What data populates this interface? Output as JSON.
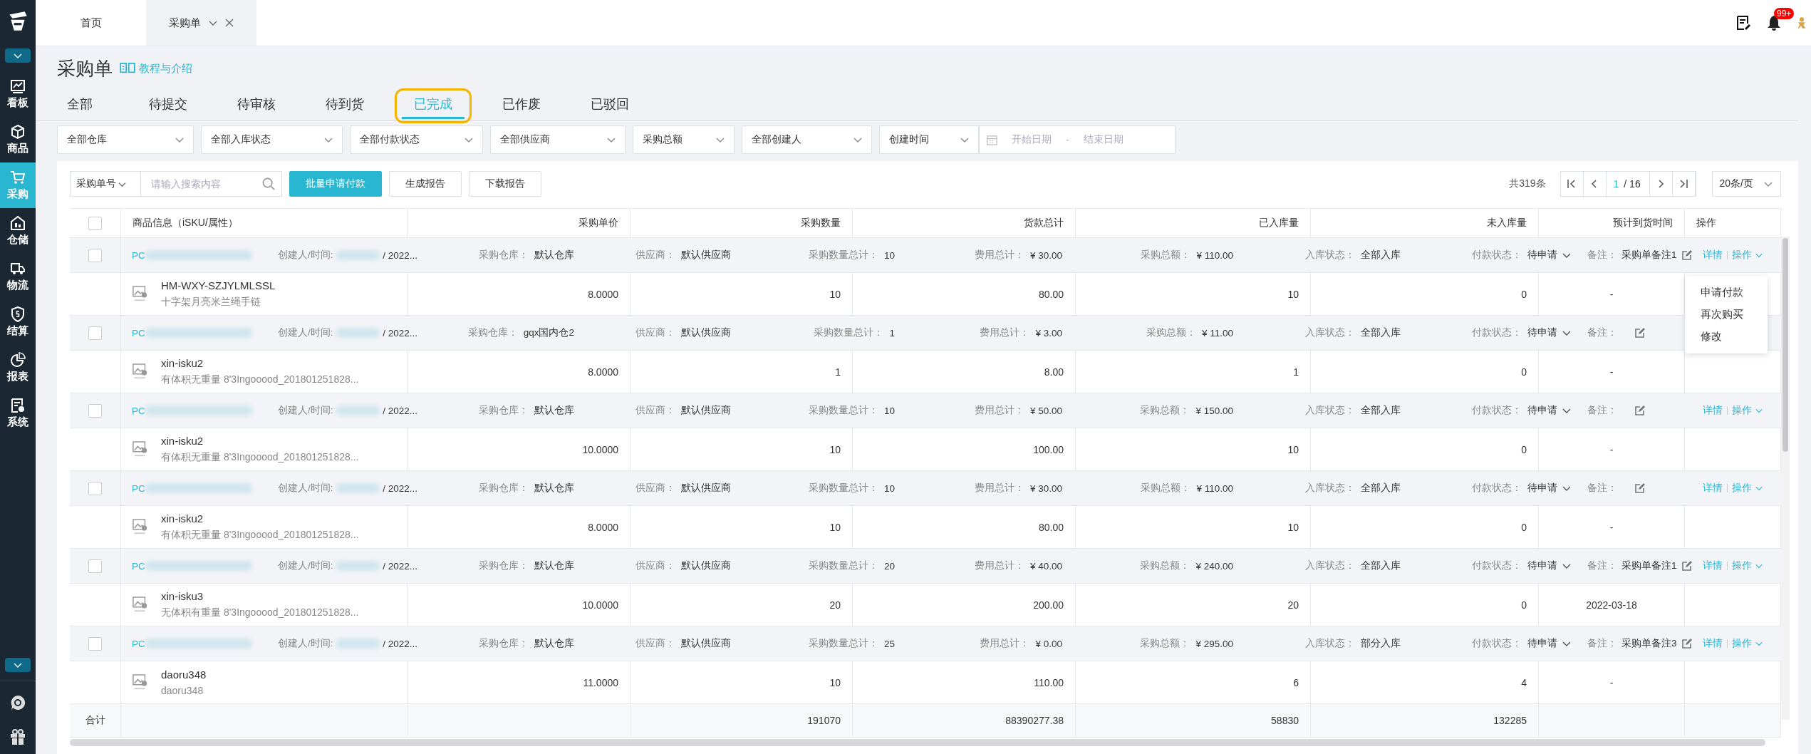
{
  "sidebar": {
    "items": [
      {
        "label": "看板",
        "kind": "chart",
        "selected": false
      },
      {
        "label": "商品",
        "kind": "cube",
        "selected": false
      },
      {
        "label": "采购",
        "kind": "cart",
        "selected": true
      },
      {
        "label": "仓储",
        "kind": "warehouse",
        "selected": false
      },
      {
        "label": "物流",
        "kind": "truck",
        "selected": false
      },
      {
        "label": "结算",
        "kind": "shield",
        "selected": false
      },
      {
        "label": "报表",
        "kind": "pie",
        "selected": false
      },
      {
        "label": "系统",
        "kind": "doc",
        "selected": false
      }
    ]
  },
  "top_tabs": [
    {
      "label": "首页",
      "selected": false,
      "closable": false
    },
    {
      "label": "采购单",
      "selected": true,
      "closable": true
    }
  ],
  "notifications": {
    "badge": "99+"
  },
  "page": {
    "title": "采购单",
    "help_link": "教程与介绍"
  },
  "status_tabs": [
    {
      "label": "全部",
      "selected": false,
      "highlighted": false
    },
    {
      "label": "待提交",
      "selected": false,
      "highlighted": false
    },
    {
      "label": "待审核",
      "selected": false,
      "highlighted": false
    },
    {
      "label": "待到货",
      "selected": false,
      "highlighted": false
    },
    {
      "label": "已完成",
      "selected": true,
      "highlighted": true
    },
    {
      "label": "已作废",
      "selected": false,
      "highlighted": false
    },
    {
      "label": "已驳回",
      "selected": false,
      "highlighted": false
    }
  ],
  "filters": [
    {
      "label": "全部仓库"
    },
    {
      "label": "全部入库状态"
    },
    {
      "label": "全部付款状态"
    },
    {
      "label": "全部供应商"
    },
    {
      "label": "采购总额"
    },
    {
      "label": "全部创建人"
    },
    {
      "label": "创建时间"
    }
  ],
  "date_range": {
    "start_placeholder": "开始日期",
    "separator": "-",
    "end_placeholder": "结束日期"
  },
  "toolbar": {
    "search_type": "采购单号",
    "search_placeholder": "请输入搜索内容",
    "buttons": [
      {
        "label": "批量申请付款",
        "primary": true
      },
      {
        "label": "生成报告",
        "primary": false
      },
      {
        "label": "下载报告",
        "primary": false
      }
    ],
    "total": "共319条",
    "page": "1",
    "pages": "/ 16",
    "page_size": "20条/页"
  },
  "table": {
    "select_all_checked": false,
    "columns": [
      "商品信息（iSKU/属性）",
      "采购单价",
      "采购数量",
      "货款总计",
      "已入库量",
      "未入库量",
      "预计到货时间",
      "操作"
    ],
    "orders": [
      {
        "checked": false,
        "po": "PC",
        "menu_open": true,
        "actions": [
          "详情",
          "操作"
        ],
        "fields": [
          {
            "kind": "creator",
            "label": "创建人/时间:",
            "value": "/ 2022..."
          },
          {
            "kind": "text",
            "label": "采购仓库：",
            "value": "默认仓库"
          },
          {
            "kind": "text",
            "label": "供应商：",
            "value": "默认供应商"
          },
          {
            "kind": "text",
            "label": "采购数量总计：",
            "value": "10"
          },
          {
            "kind": "text",
            "label": "费用总计：",
            "value": "¥ 30.00"
          },
          {
            "kind": "text",
            "label": "采购总额：",
            "value": "¥ 110.00"
          },
          {
            "kind": "text",
            "label": "入库状态：",
            "value": "全部入库"
          },
          {
            "kind": "status",
            "label": "付款状态：",
            "value": "待申请"
          },
          {
            "kind": "note",
            "label": "备注：",
            "value": "采购单备注1"
          }
        ],
        "item": {
          "sku": "HM-WXY-SZJYLMLSSL",
          "attr": "十字架月亮米兰绳手链",
          "price": "8.0000",
          "qty": "10",
          "amount": "80.00",
          "received": "10",
          "pending": "0",
          "eta": "-"
        }
      },
      {
        "checked": false,
        "po": "PC",
        "menu_open": false,
        "fields": [
          {
            "kind": "creator",
            "label": "创建人/时间:",
            "value": "/ 2022..."
          },
          {
            "kind": "text",
            "label": "采购仓库：",
            "value": "gqx国内仓2"
          },
          {
            "kind": "text",
            "label": "供应商：",
            "value": "默认供应商"
          },
          {
            "kind": "text",
            "label": "采购数量总计：",
            "value": "1"
          },
          {
            "kind": "text",
            "label": "费用总计：",
            "value": "¥ 3.00"
          },
          {
            "kind": "text",
            "label": "采购总额：",
            "value": "¥ 11.00"
          },
          {
            "kind": "text",
            "label": "入库状态：",
            "value": "全部入库"
          },
          {
            "kind": "status",
            "label": "付款状态：",
            "value": "待申请"
          },
          {
            "kind": "note",
            "label": "备注："
          }
        ],
        "item": {
          "sku": "xin-isku2",
          "attr": "有体积无重量 8'3Ingooood_201801251828...",
          "price": "8.0000",
          "qty": "1",
          "amount": "8.00",
          "received": "1",
          "pending": "0",
          "eta": "-"
        }
      },
      {
        "checked": false,
        "po": "PC",
        "menu_open": false,
        "actions": [
          "详情",
          "操作"
        ],
        "fields": [
          {
            "kind": "creator",
            "label": "创建人/时间:",
            "value": "/ 2022..."
          },
          {
            "kind": "text",
            "label": "采购仓库：",
            "value": "默认仓库"
          },
          {
            "kind": "text",
            "label": "供应商：",
            "value": "默认供应商"
          },
          {
            "kind": "text",
            "label": "采购数量总计：",
            "value": "10"
          },
          {
            "kind": "text",
            "label": "费用总计：",
            "value": "¥ 50.00"
          },
          {
            "kind": "text",
            "label": "采购总额：",
            "value": "¥ 150.00"
          },
          {
            "kind": "text",
            "label": "入库状态：",
            "value": "全部入库"
          },
          {
            "kind": "status",
            "label": "付款状态：",
            "value": "待申请"
          },
          {
            "kind": "note",
            "label": "备注："
          }
        ],
        "item": {
          "sku": "xin-isku2",
          "attr": "有体积无重量 8'3Ingooood_201801251828...",
          "price": "10.0000",
          "qty": "10",
          "amount": "100.00",
          "received": "10",
          "pending": "0",
          "eta": "-"
        }
      },
      {
        "checked": false,
        "po": "PC",
        "menu_open": false,
        "actions": [
          "详情",
          "操作"
        ],
        "fields": [
          {
            "kind": "creator",
            "label": "创建人/时间:",
            "value": "/ 2022..."
          },
          {
            "kind": "text",
            "label": "采购仓库：",
            "value": "默认仓库"
          },
          {
            "kind": "text",
            "label": "供应商：",
            "value": "默认供应商"
          },
          {
            "kind": "text",
            "label": "采购数量总计：",
            "value": "10"
          },
          {
            "kind": "text",
            "label": "费用总计：",
            "value": "¥ 30.00"
          },
          {
            "kind": "text",
            "label": "采购总额：",
            "value": "¥ 110.00"
          },
          {
            "kind": "text",
            "label": "入库状态：",
            "value": "全部入库"
          },
          {
            "kind": "status",
            "label": "付款状态：",
            "value": "待申请"
          },
          {
            "kind": "note",
            "label": "备注："
          }
        ],
        "item": {
          "sku": "xin-isku2",
          "attr": "有体积无重量 8'3Ingooood_201801251828...",
          "price": "8.0000",
          "qty": "10",
          "amount": "80.00",
          "received": "10",
          "pending": "0",
          "eta": "-"
        }
      },
      {
        "checked": false,
        "po": "PC",
        "menu_open": false,
        "actions": [
          "详情",
          "操作"
        ],
        "fields": [
          {
            "kind": "creator",
            "label": "创建人/时间:",
            "value": "/ 2022..."
          },
          {
            "kind": "text",
            "label": "采购仓库：",
            "value": "默认仓库"
          },
          {
            "kind": "text",
            "label": "供应商：",
            "value": "默认供应商"
          },
          {
            "kind": "text",
            "label": "采购数量总计：",
            "value": "20"
          },
          {
            "kind": "text",
            "label": "费用总计：",
            "value": "¥ 40.00"
          },
          {
            "kind": "text",
            "label": "采购总额：",
            "value": "¥ 240.00"
          },
          {
            "kind": "text",
            "label": "入库状态：",
            "value": "全部入库"
          },
          {
            "kind": "status",
            "label": "付款状态：",
            "value": "待申请"
          },
          {
            "kind": "note",
            "label": "备注：",
            "value": "采购单备注1"
          }
        ],
        "item": {
          "sku": "xin-isku3",
          "attr": "无体积有重量 8'3Ingooood_201801251828...",
          "price": "10.0000",
          "qty": "20",
          "amount": "200.00",
          "received": "20",
          "pending": "0",
          "eta": "2022-03-18"
        }
      },
      {
        "checked": false,
        "po": "PC",
        "menu_open": false,
        "actions": [
          "详情",
          "操作"
        ],
        "fields": [
          {
            "kind": "creator",
            "label": "创建人/时间:",
            "value": "/ 2022..."
          },
          {
            "kind": "text",
            "label": "采购仓库：",
            "value": "默认仓库"
          },
          {
            "kind": "text",
            "label": "供应商：",
            "value": "默认供应商"
          },
          {
            "kind": "text",
            "label": "采购数量总计：",
            "value": "25"
          },
          {
            "kind": "text",
            "label": "费用总计：",
            "value": "¥ 0.00"
          },
          {
            "kind": "text",
            "label": "采购总额：",
            "value": "¥ 295.00"
          },
          {
            "kind": "text",
            "label": "入库状态：",
            "value": "部分入库"
          },
          {
            "kind": "status",
            "label": "付款状态：",
            "value": "待申请"
          },
          {
            "kind": "note",
            "label": "备注：",
            "value": "采购单备注3"
          }
        ],
        "item": {
          "sku": "daoru348",
          "attr": "daoru348",
          "price": "11.0000",
          "qty": "10",
          "amount": "110.00",
          "received": "6",
          "pending": "4",
          "eta": "-"
        }
      }
    ],
    "menu": {
      "items": [
        "申请付款",
        "再次购买",
        "修改"
      ]
    },
    "totals": {
      "label": "合计",
      "qty": "191070",
      "amount": "88390277.38",
      "received": "58830",
      "pending": "132285"
    }
  }
}
